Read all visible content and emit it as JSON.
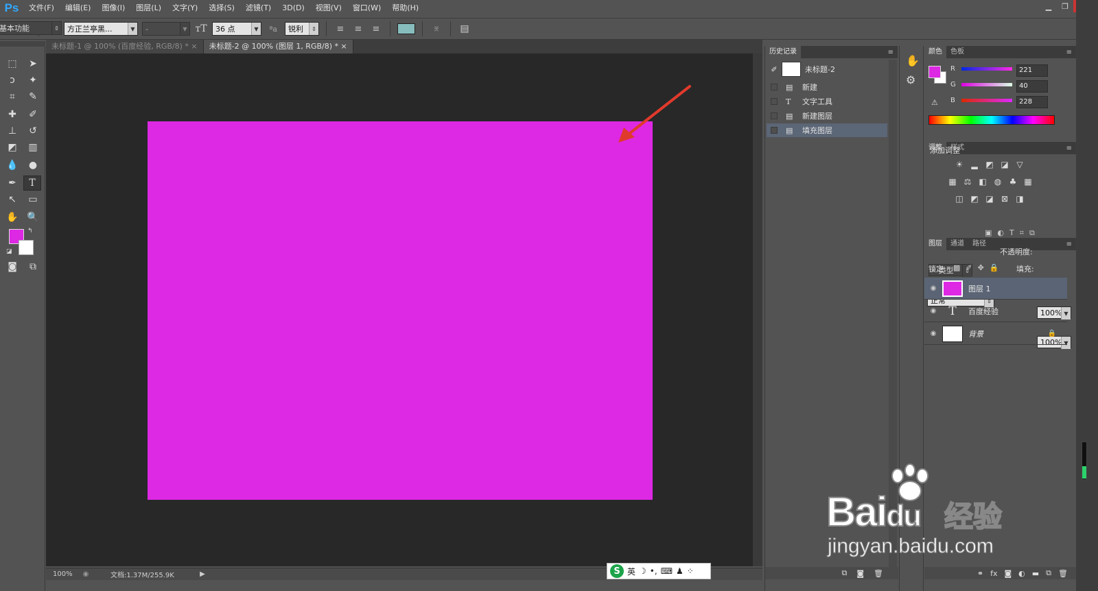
{
  "app": {
    "logo": "Ps"
  },
  "menu": [
    "文件(F)",
    "编辑(E)",
    "图像(I)",
    "图层(L)",
    "文字(Y)",
    "选择(S)",
    "滤镜(T)",
    "3D(D)",
    "视图(V)",
    "窗口(W)",
    "帮助(H)"
  ],
  "options": {
    "font_family": "方正兰亭黑...",
    "font_style": "-",
    "font_size": "36 点",
    "aa_label": "ªa",
    "antialias": "锐利",
    "text_color": "#88bdbd",
    "workspace": "基本功能"
  },
  "tabs": [
    {
      "label": "未标题-1 @ 100% (百度经验, RGB/8) *",
      "close": "×",
      "active": false
    },
    {
      "label": "未标题-2 @ 100% (图层 1, RGB/8) *",
      "close": "×",
      "active": true
    }
  ],
  "canvas": {
    "fill_color": "#dd28e4",
    "background": "#282828"
  },
  "status": {
    "zoom": "100%",
    "doc": "文档:1.37M/255.9K"
  },
  "ime": {
    "label": "英"
  },
  "history": {
    "tab": "历史记录",
    "snapshot": "未标题-2",
    "items": [
      "新建",
      "文字工具",
      "新建图层",
      "填充图层"
    ],
    "selected": 3
  },
  "color_panel": {
    "tabs": [
      "颜色",
      "色板"
    ],
    "r_label": "R",
    "g_label": "G",
    "b_label": "B",
    "r": "221",
    "g": "40",
    "b": "228",
    "fg": "#dd28e4",
    "bg": "#ffffff"
  },
  "adjust_panel": {
    "tabs": [
      "调整",
      "样式"
    ],
    "title": "添加调整"
  },
  "layers_panel": {
    "tabs": [
      "图层",
      "通道",
      "路径"
    ],
    "filter": "类型",
    "blend": "正常",
    "opacity_label": "不透明度:",
    "opacity": "100%",
    "lock_label": "锁定:",
    "fill_label": "填充:",
    "fill": "100%",
    "layers": [
      {
        "name": "图层 1",
        "type": "color",
        "color": "#dd28e4",
        "selected": true
      },
      {
        "name": "百度经验",
        "type": "text",
        "selected": false
      },
      {
        "name": "背景",
        "type": "white",
        "selected": false
      }
    ]
  },
  "watermark": {
    "brand": "Bai",
    "brand2": "du",
    "cn": "经验",
    "url": "jingyan.baidu.com"
  }
}
